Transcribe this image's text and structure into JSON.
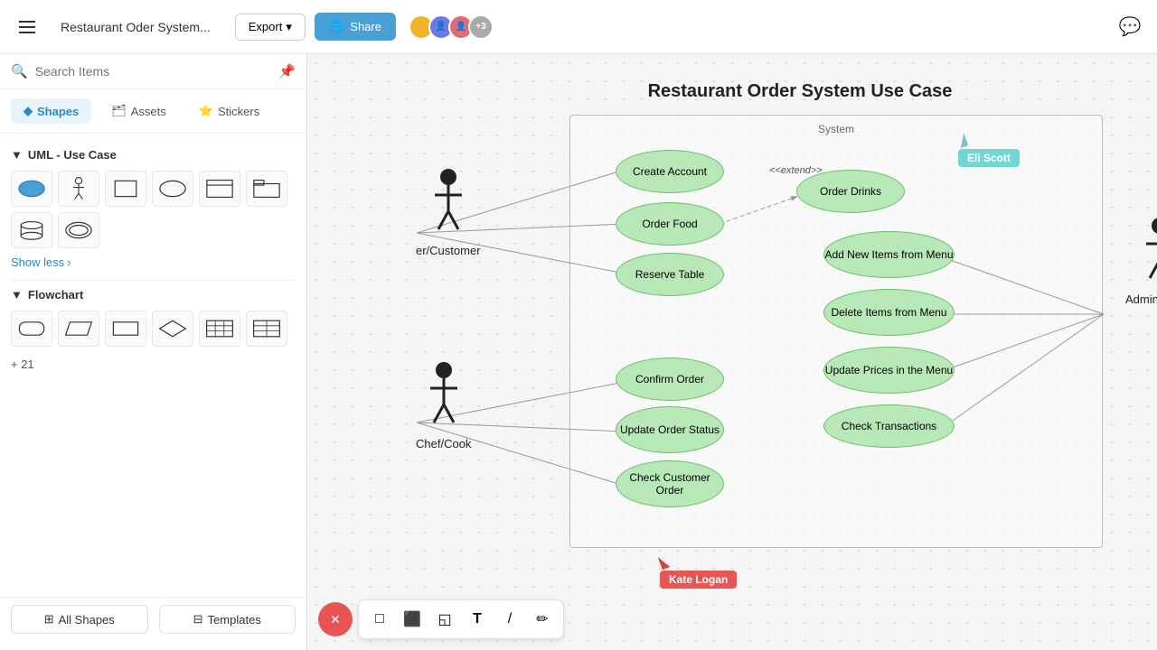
{
  "topbar": {
    "menu_icon": "menu-icon",
    "doc_title": "Restaurant Oder System...",
    "export_label": "Export",
    "share_label": "Share",
    "avatar_colors": [
      "#f0b429",
      "#6c7ae0",
      "#e06c75"
    ],
    "avatar_count": "+3",
    "chat_icon": "💬"
  },
  "left_panel": {
    "search_placeholder": "Search Items",
    "tabs": [
      {
        "id": "shapes",
        "label": "Shapes",
        "active": true,
        "icon": "◆"
      },
      {
        "id": "assets",
        "label": "Assets",
        "active": false,
        "icon": "🗂"
      },
      {
        "id": "stickers",
        "label": "Stickers",
        "active": false,
        "icon": "⭐"
      }
    ],
    "sections": [
      {
        "id": "uml-use-case",
        "label": "UML - Use Case",
        "collapsed": false,
        "shapes": [
          "ellipse",
          "actor",
          "rectangle",
          "oval",
          "boundary",
          "package",
          "cylinder"
        ]
      },
      {
        "id": "flowchart",
        "label": "Flowchart",
        "collapsed": false,
        "shapes": [
          "rounded-rect",
          "parallelogram",
          "rect",
          "diamond",
          "table1",
          "table2"
        ]
      }
    ],
    "show_less": "Show less",
    "more_count": "+ 21",
    "all_shapes_label": "All Shapes",
    "templates_label": "Templates"
  },
  "diagram": {
    "title": "Restaurant Order System Use Case",
    "system_label": "System",
    "actors": [
      {
        "id": "customer",
        "label": "er/Customer"
      },
      {
        "id": "chef",
        "label": "Chef/Cook"
      },
      {
        "id": "admin",
        "label": "Administrator"
      }
    ],
    "use_cases": [
      {
        "id": "create-account",
        "label": "Create Account"
      },
      {
        "id": "order-food",
        "label": "Order Food"
      },
      {
        "id": "order-drinks",
        "label": "Order Drinks"
      },
      {
        "id": "reserve-table",
        "label": "Reserve Table"
      },
      {
        "id": "add-new-items",
        "label": "Add New Items from Menu"
      },
      {
        "id": "delete-items",
        "label": "Delete Items from Menu"
      },
      {
        "id": "update-prices",
        "label": "Update Prices in the Menu"
      },
      {
        "id": "confirm-order",
        "label": "Confirm Order"
      },
      {
        "id": "update-order-status",
        "label": "Update Order Status"
      },
      {
        "id": "check-customer-order",
        "label": "Check Customer Order"
      },
      {
        "id": "check-transactions",
        "label": "Check Transactions"
      }
    ],
    "extend_label": "<<extend>>",
    "user_cursors": [
      {
        "id": "eli-scott",
        "name": "Eli Scott",
        "color": "#00b4b4",
        "arrow_color": "#1a8a8a"
      },
      {
        "id": "kate-logan",
        "name": "Kate Logan",
        "color": "#e85555",
        "arrow_color": "#c44"
      }
    ]
  },
  "bottom_tools": [
    {
      "id": "rect-tool",
      "icon": "□"
    },
    {
      "id": "frame-tool",
      "icon": "⬛"
    },
    {
      "id": "sticky-tool",
      "icon": "◱"
    },
    {
      "id": "text-tool",
      "icon": "T"
    },
    {
      "id": "line-tool",
      "icon": "/"
    },
    {
      "id": "draw-tool",
      "icon": "✏"
    }
  ],
  "close_btn": "✕"
}
